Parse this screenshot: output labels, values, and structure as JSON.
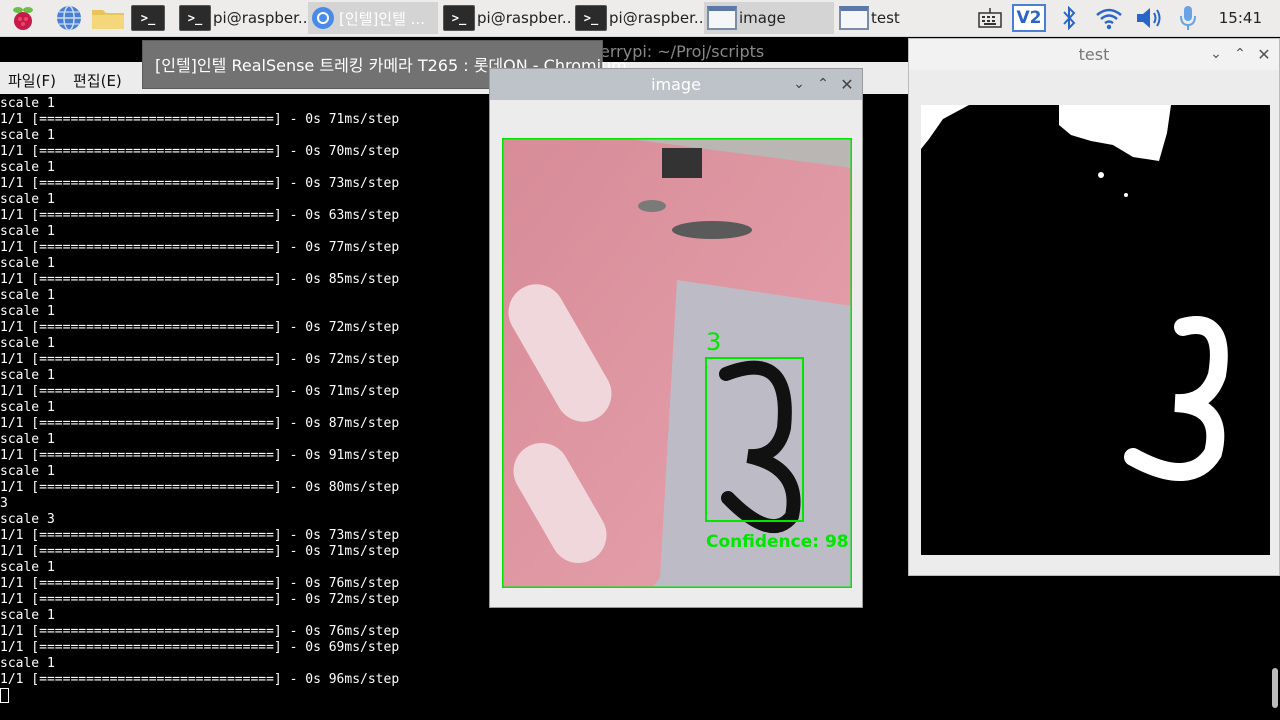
{
  "taskbar": {
    "items": [
      {
        "label": "pi@raspber..."
      },
      {
        "label": "[인텔]인텔 ..."
      },
      {
        "label": "pi@raspber..."
      },
      {
        "label": "pi@raspber..."
      },
      {
        "label": "image"
      },
      {
        "label": "test"
      }
    ],
    "tray": {
      "vnc_label": "V2"
    },
    "clock": "15:41"
  },
  "tooltip": "[인텔]인텔 RealSense 트레킹 카메라 T265 : 롯데ON - Chromium",
  "terminal": {
    "title": "errypi: ~/Proj/scripts",
    "menu": [
      "파일(F)",
      "편집(E)"
    ],
    "lines": [
      "scale 1",
      "1/1 [==============================] - 0s 71ms/step",
      "scale 1",
      "1/1 [==============================] - 0s 70ms/step",
      "scale 1",
      "1/1 [==============================] - 0s 73ms/step",
      "scale 1",
      "1/1 [==============================] - 0s 63ms/step",
      "scale 1",
      "1/1 [==============================] - 0s 77ms/step",
      "scale 1",
      "1/1 [==============================] - 0s 85ms/step",
      "scale 1",
      "scale 1",
      "1/1 [==============================] - 0s 72ms/step",
      "scale 1",
      "1/1 [==============================] - 0s 72ms/step",
      "scale 1",
      "1/1 [==============================] - 0s 71ms/step",
      "scale 1",
      "1/1 [==============================] - 0s 87ms/step",
      "scale 1",
      "1/1 [==============================] - 0s 91ms/step",
      "scale 1",
      "1/1 [==============================] - 0s 80ms/step",
      "3",
      "scale 3",
      "1/1 [==============================] - 0s 73ms/step",
      "1/1 [==============================] - 0s 71ms/step",
      "scale 1",
      "1/1 [==============================] - 0s 76ms/step",
      "1/1 [==============================] - 0s 72ms/step",
      "scale 1",
      "1/1 [==============================] - 0s 76ms/step",
      "1/1 [==============================] - 0s 69ms/step",
      "scale 1",
      "1/1 [==============================] - 0s 96ms/step"
    ]
  },
  "image_window": {
    "title": "image",
    "detection_label": "3",
    "confidence_text": "Confidence: 98",
    "box_color": "#00e600"
  },
  "test_window": {
    "title": "test"
  }
}
